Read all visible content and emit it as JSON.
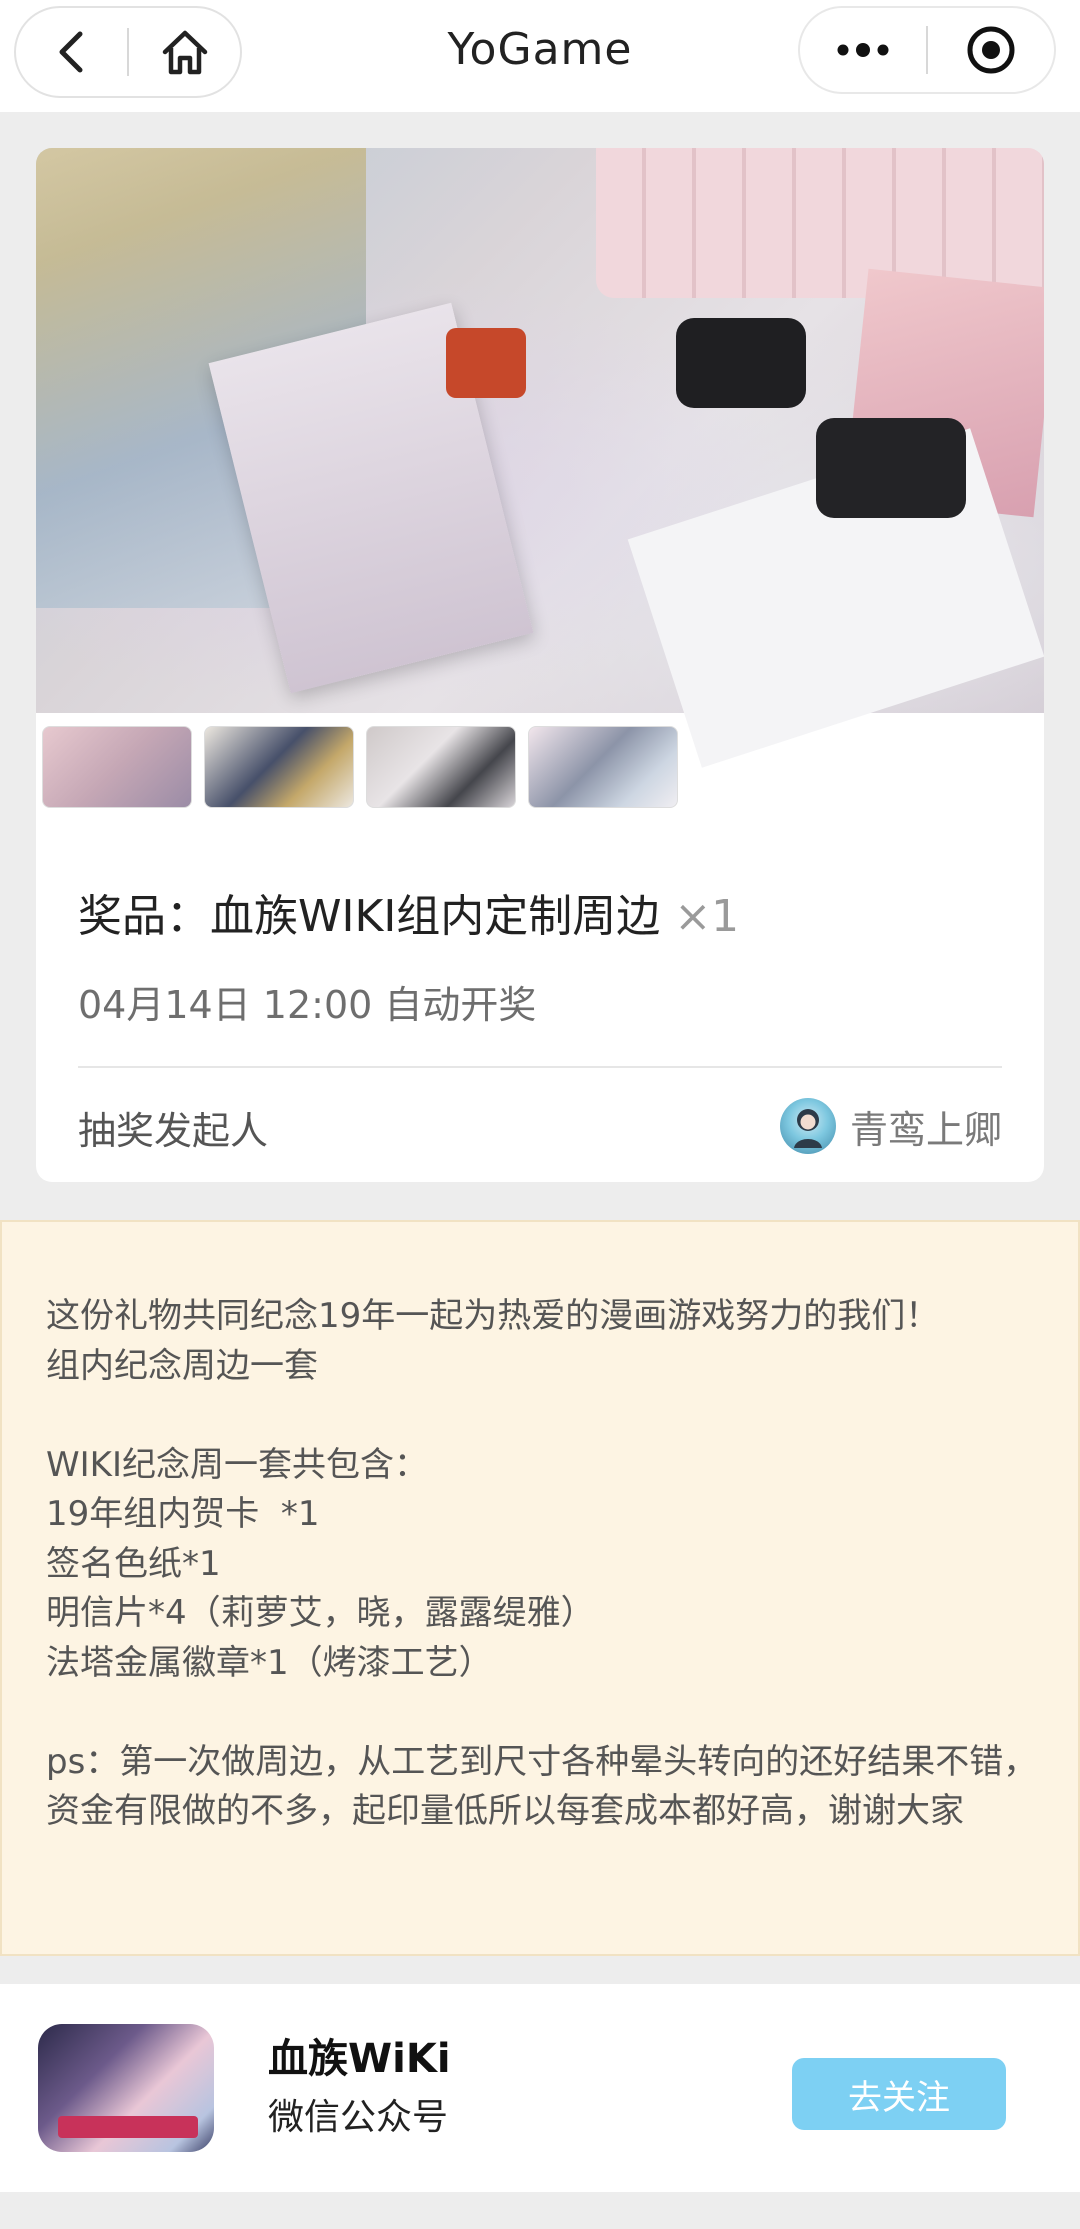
{
  "navbar": {
    "title": "YoGame"
  },
  "prize": {
    "label": "奖品：血族WIKI组内定制周边",
    "quantity": "×1",
    "draw_time": "04月14日 12:00 自动开奖",
    "initiator_label": "抽奖发起人",
    "initiator_name": "青鸾上卿",
    "thumbnail_count": 4
  },
  "description": {
    "text": "这份礼物共同纪念19年一起为热爱的漫画游戏努力的我们！\n组内纪念周边一套\n\nWIKI纪念周一套共包含：\n19年组内贺卡  *1\n签名色纸*1\n明信片*4（莉萝艾，晓，露露缇雅）\n法塔金属徽章*1（烤漆工艺）\n\nps：第一次做周边，从工艺到尺寸各种晕头转向的还好结果不错，资金有限做的不多，起印量低所以每套成本都好高，谢谢大家"
  },
  "account": {
    "name": "血族WiKi",
    "type": "微信公众号",
    "follow_label": "去关注"
  },
  "icons": {
    "back": "chevron-left-icon",
    "home": "home-icon",
    "more": "more-dots-icon",
    "close": "target-circle-icon"
  },
  "colors": {
    "follow_button": "#7dd0f3",
    "description_bg": "#fdf4e3",
    "page_bg": "#ededed"
  }
}
